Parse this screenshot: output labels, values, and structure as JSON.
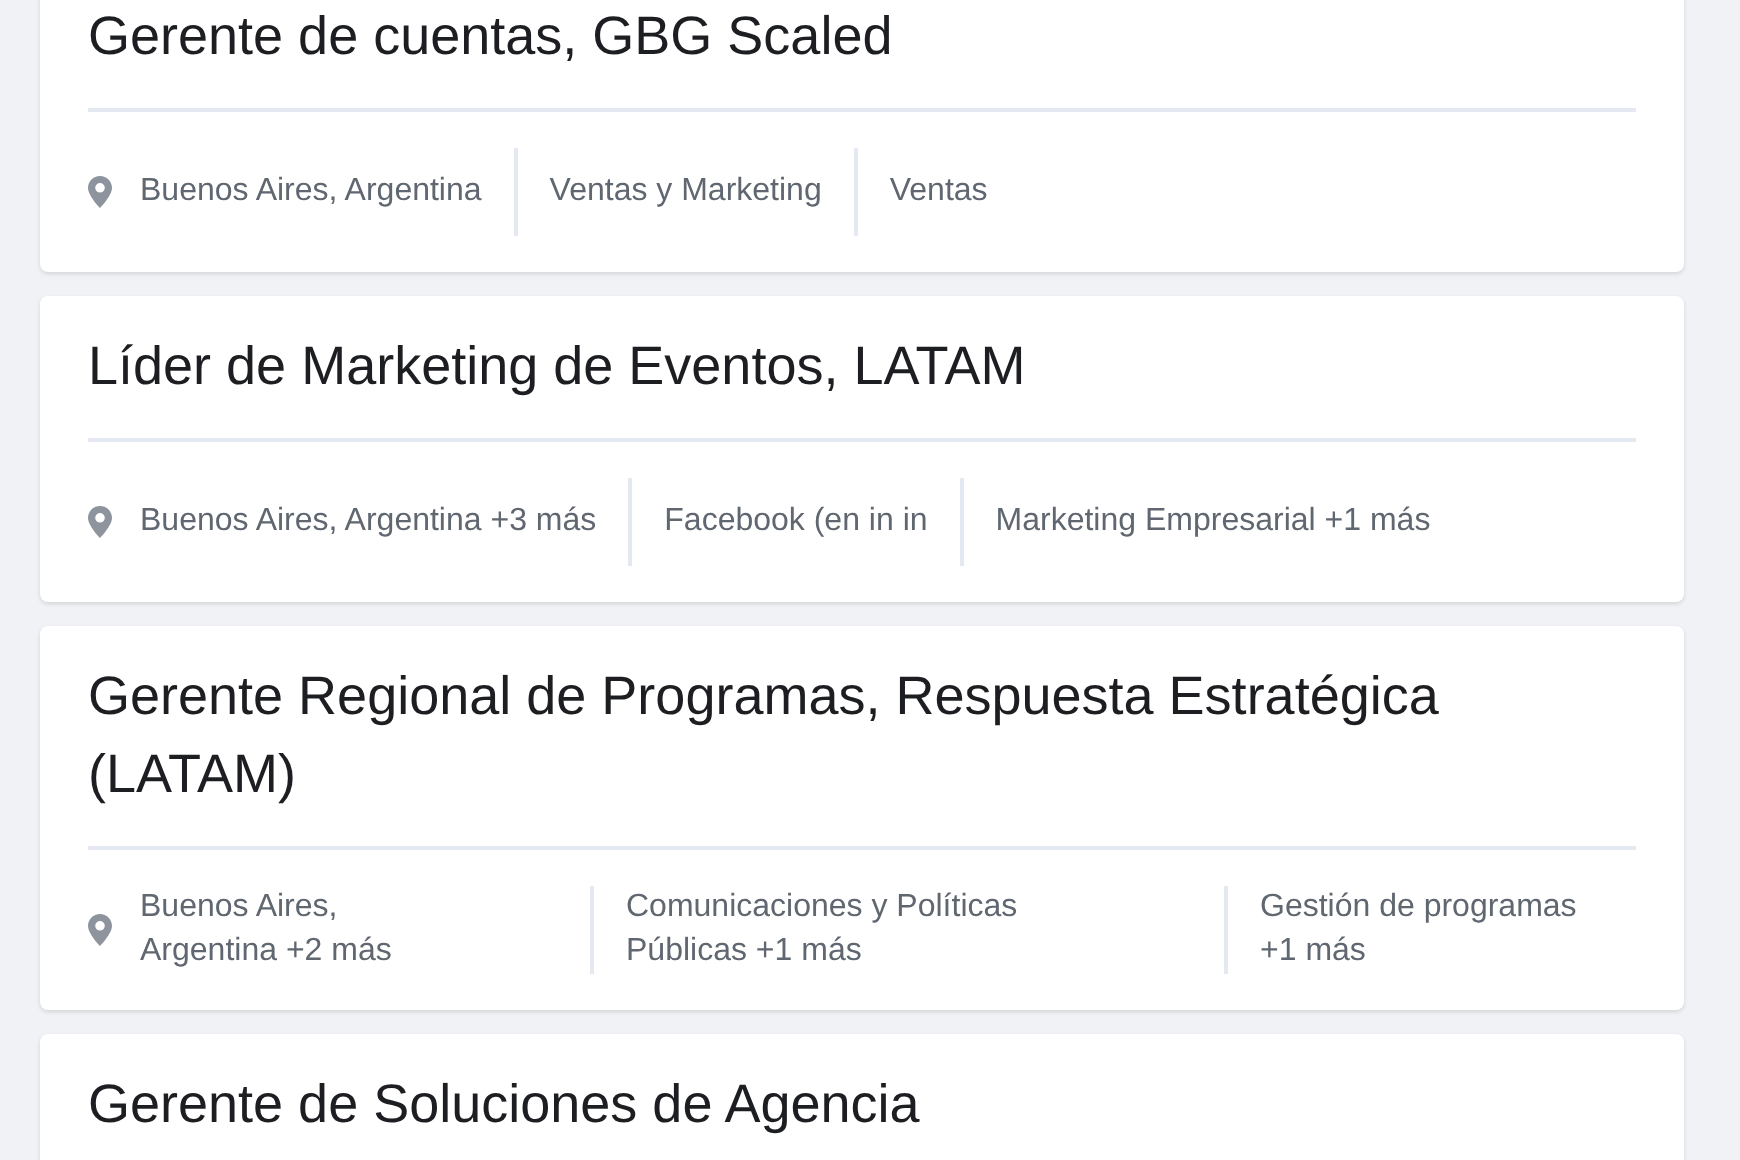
{
  "jobs": [
    {
      "title": "Gerente de cuentas, GBG Scaled",
      "kind": "inline",
      "meta": [
        "Buenos Aires, Argentina",
        "Ventas y Marketing",
        "Ventas"
      ]
    },
    {
      "title": "Líder de Marketing de Eventos, LATAM",
      "kind": "inline",
      "meta": [
        "Buenos Aires, Argentina +3 más",
        "Facebook (en in in",
        "Marketing Empresarial +1 más"
      ]
    },
    {
      "title": "Gerente Regional de Programas, Respuesta Estratégica (LATAM)",
      "kind": "columns",
      "meta": [
        "Buenos Aires, Argentina +2 más",
        "Comunicaciones y Políticas Públicas +1 más",
        "Gestión de programas +1 más"
      ]
    },
    {
      "title": "Gerente de Soluciones de Agencia",
      "kind": "inline"
    }
  ]
}
